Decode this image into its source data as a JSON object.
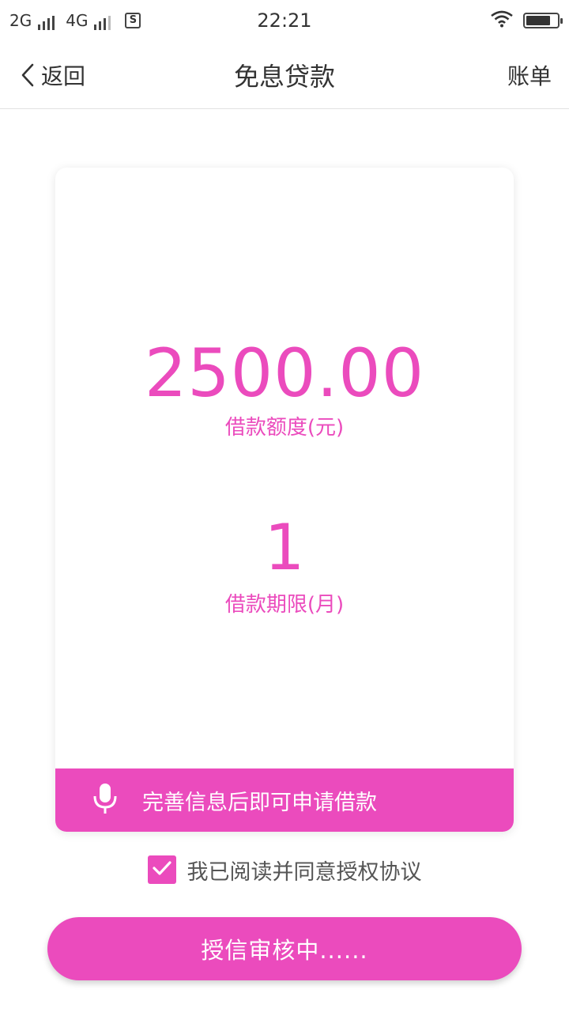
{
  "status_bar": {
    "network1": "2G",
    "network2": "4G",
    "time": "22:21",
    "sim_icon": "S",
    "icons": [
      "signal-icon",
      "sim-icon",
      "wifi-icon",
      "battery-icon"
    ]
  },
  "nav": {
    "back_label": "返回",
    "title": "免息贷款",
    "bill_label": "账单"
  },
  "loan": {
    "amount": "2500.00",
    "amount_label": "借款额度(元)",
    "term": "1",
    "term_label": "借款期限(月)"
  },
  "notice": {
    "icon": "microphone-icon",
    "text": "完善信息后即可申请借款"
  },
  "agreement": {
    "checked": true,
    "text": "我已阅读并同意授权协议"
  },
  "primary_button": {
    "label": "授信审核中......"
  },
  "colors": {
    "accent": "#eb4bbd"
  }
}
